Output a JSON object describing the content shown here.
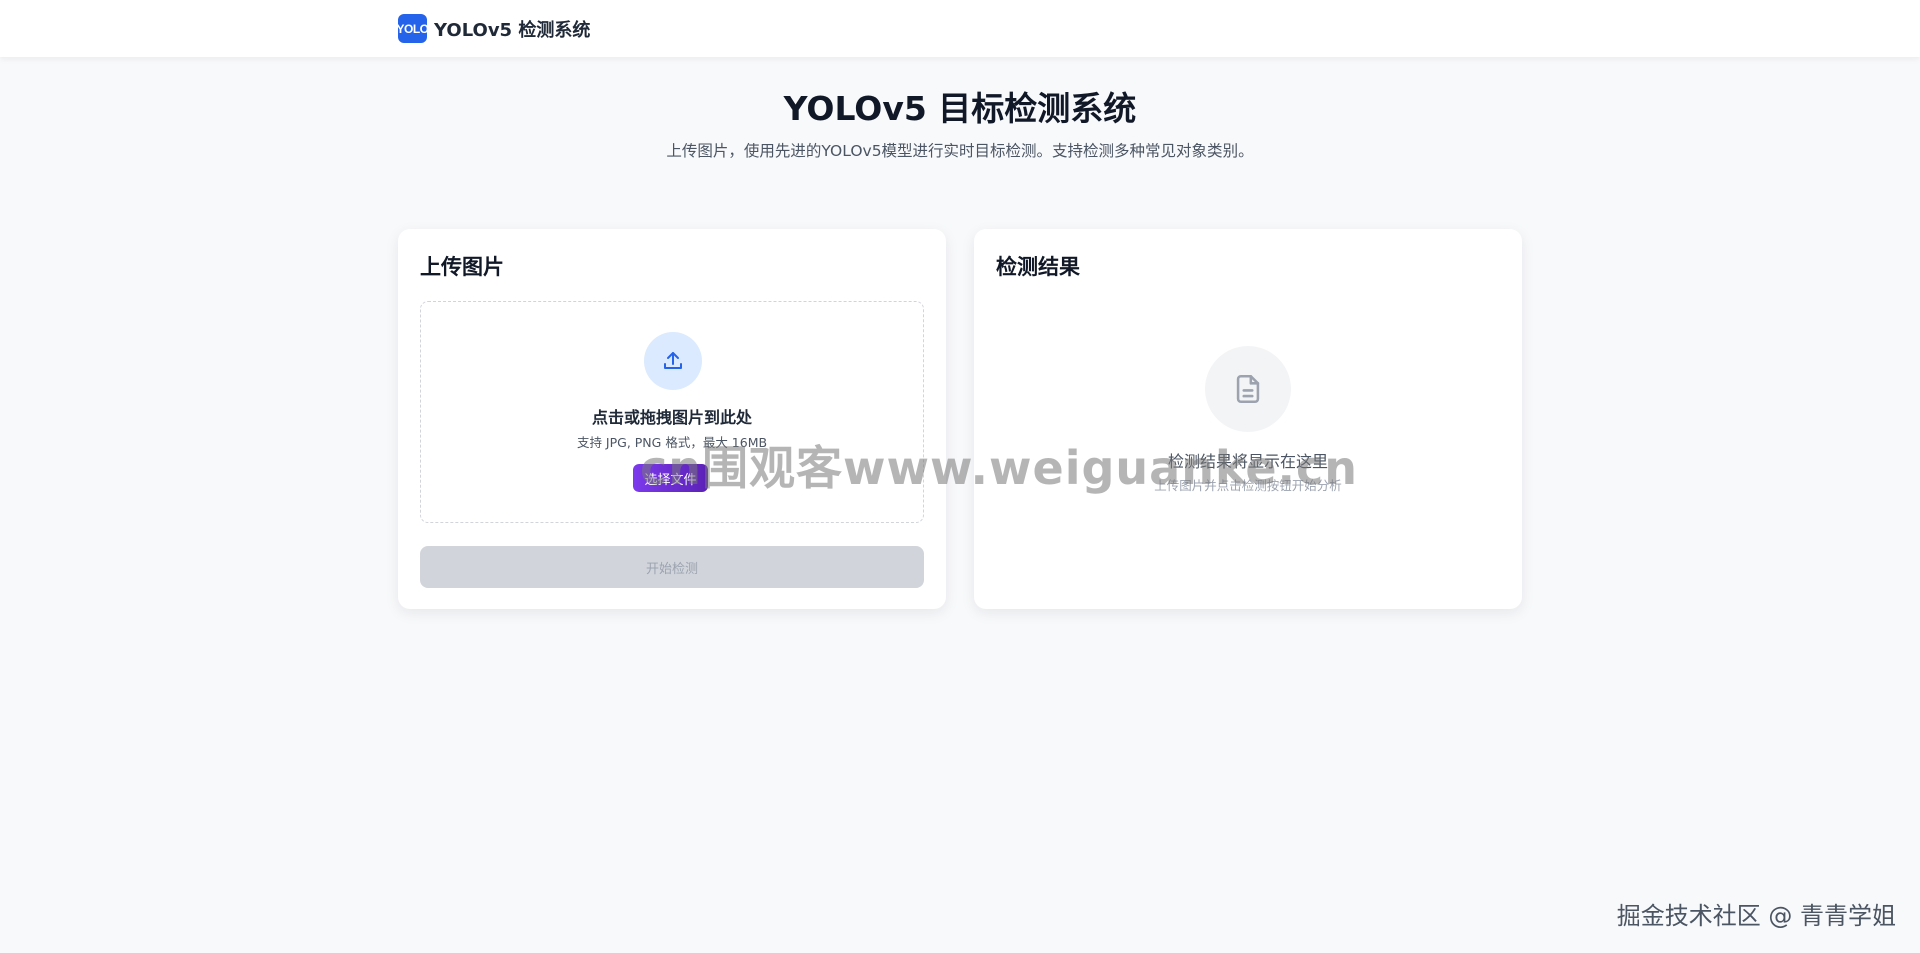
{
  "navbar": {
    "logo_text": "YOLO",
    "brand": "YOLOv5 检测系统"
  },
  "hero": {
    "title": "YOLOv5 目标检测系统",
    "subtitle": "上传图片，使用先进的YOLOv5模型进行实时目标检测。支持检测多种常见对象类别。"
  },
  "upload_card": {
    "title": "上传图片",
    "drop_title": "点击或拖拽图片到此处",
    "drop_hint": "支持 JPG, PNG 格式，最大 16MB",
    "choose_button": "选择文件",
    "detect_button": "开始检测",
    "upload_icon": "upload-icon"
  },
  "result_card": {
    "title": "检测结果",
    "empty_title": "检测结果将显示在这里",
    "empty_hint": "上传图片并点击检测按钮开始分析",
    "empty_icon": "document-icon"
  },
  "overlay": {
    "watermark": "cn围观客www.weiguanke.cn",
    "credit": "掘金技术社区 @ 青青学姐"
  },
  "colors": {
    "primary": "#2563eb",
    "accent": "#6d28d9",
    "background": "#f8f9fb",
    "disabled": "#d1d5db"
  }
}
